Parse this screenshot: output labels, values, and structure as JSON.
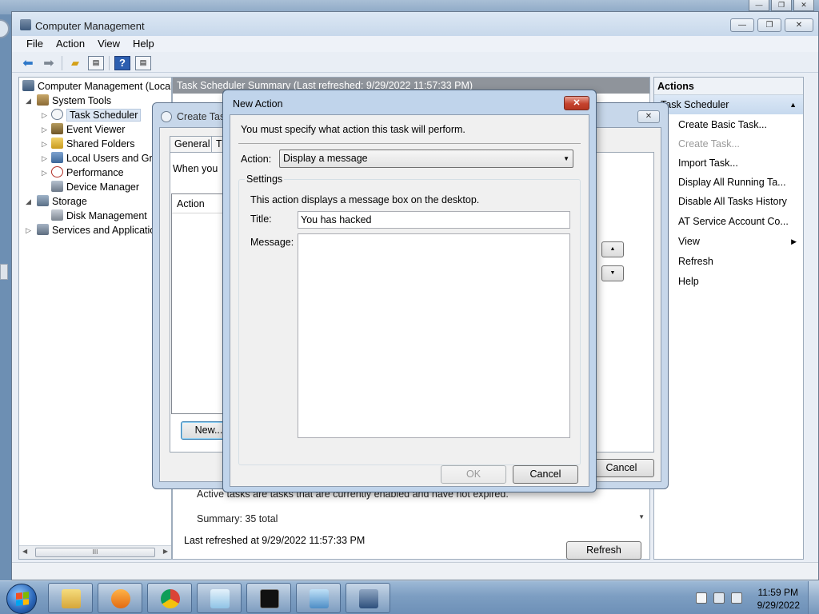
{
  "mmc": {
    "title": "Computer Management",
    "menu": [
      "File",
      "Action",
      "View",
      "Help"
    ],
    "tree": {
      "root": "Computer Management (Local",
      "system_tools": "System Tools",
      "task_scheduler": "Task Scheduler",
      "event_viewer": "Event Viewer",
      "shared_folders": "Shared Folders",
      "local_users": "Local Users and Gro",
      "performance": "Performance",
      "device_manager": "Device Manager",
      "storage": "Storage",
      "disk_management": "Disk Management",
      "services": "Services and Application"
    },
    "center": {
      "header": "Task Scheduler Summary (Last refreshed: 9/29/2022 11:57:33 PM)",
      "active_text": "Active tasks are tasks that are currently enabled and have not expired.",
      "summary": "Summary: 35 total",
      "last_refreshed": "Last refreshed at 9/29/2022 11:57:33 PM",
      "refresh_button": "Refresh"
    },
    "actions": {
      "header": "Actions",
      "section": "Task Scheduler",
      "items": {
        "create_basic": "Create Basic Task...",
        "create_task": "Create Task...",
        "import_task": "Import Task...",
        "display_running": "Display All Running Ta...",
        "disable_history": "Disable All Tasks History",
        "at_service": "AT Service Account Co...",
        "view": "View",
        "refresh": "Refresh",
        "help": "Help"
      }
    }
  },
  "create_task": {
    "title": "Create Task",
    "tabs": [
      "General",
      "Tr"
    ],
    "when_text": "When you",
    "list_header": "Action",
    "new_button": "New...",
    "cancel_button": "Cancel"
  },
  "new_action": {
    "title": "New Action",
    "close_glyph": "✕",
    "instruction": "You must specify what action this task will perform.",
    "action_label": "Action:",
    "action_value": "Display a message",
    "settings_label": "Settings",
    "description": "This action displays a message box on the desktop.",
    "title_label": "Title:",
    "title_value": "You has hacked",
    "message_label": "Message:",
    "message_value": "",
    "ok_button": "OK",
    "cancel_button": "Cancel"
  },
  "taskbar": {
    "time": "11:59 PM",
    "date": "9/29/2022"
  },
  "colors": {
    "taskbar": "#7d9ec2",
    "close_button": "#c5432e",
    "center_header": "#8f949b",
    "selection": "#dde7f3"
  }
}
